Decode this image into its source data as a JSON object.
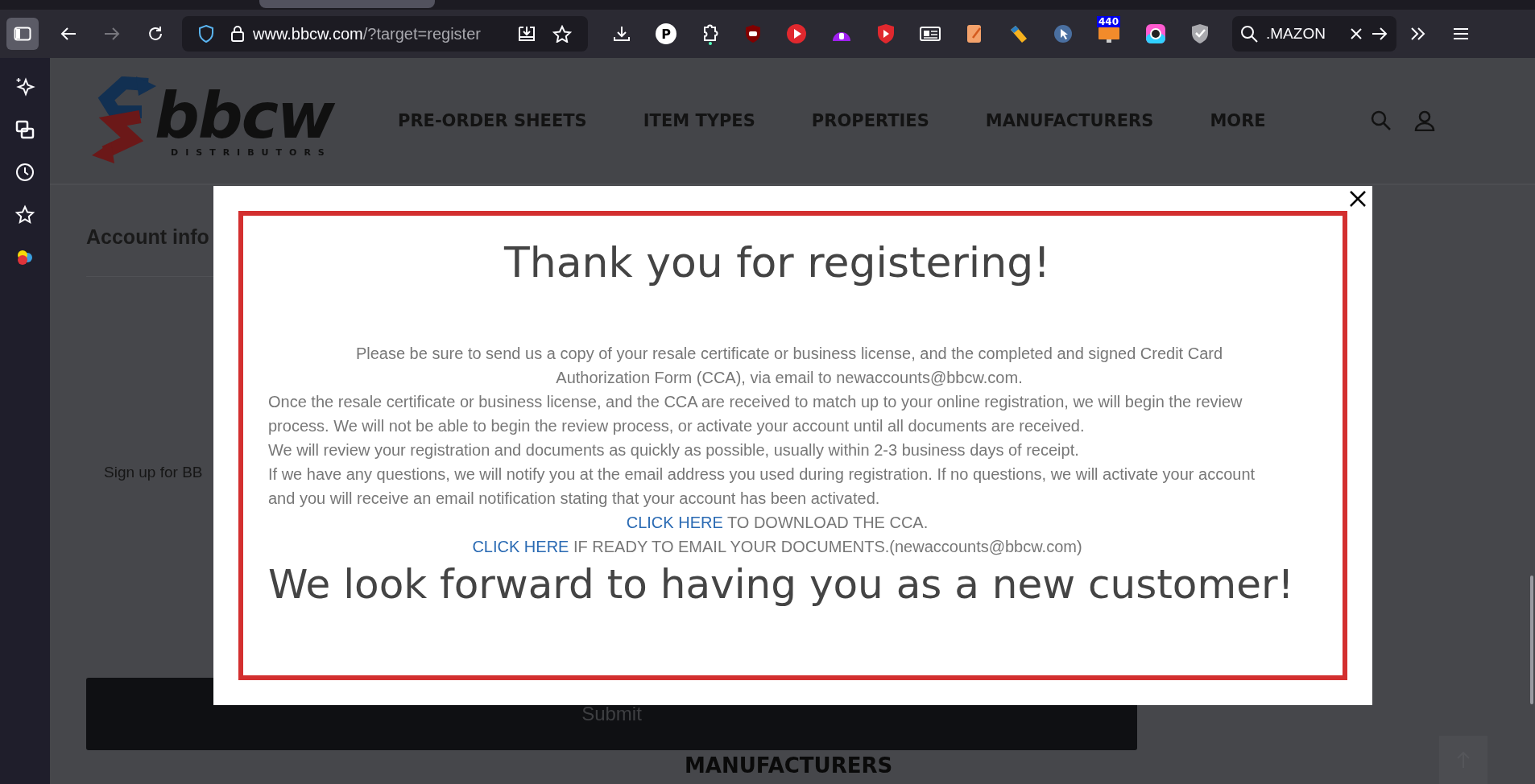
{
  "browser": {
    "url_host": "www.bbcw.com",
    "url_path": "/?target=register",
    "search_text": ".MAZON",
    "extension_letter": "P",
    "extension_badge": "440"
  },
  "site": {
    "logo_text": "bbcw",
    "logo_subtitle": "DISTRIBUTORS",
    "nav": [
      "PRE-ORDER SHEETS",
      "ITEM TYPES",
      "PROPERTIES",
      "MANUFACTURERS",
      "MORE"
    ]
  },
  "form": {
    "section_title": "Account info",
    "signup_text": "Sign up for BB",
    "submit": "Submit",
    "footer_heading": "MANUFACTURERS"
  },
  "modal": {
    "title": "Thank you for registering!",
    "intro": "Please be sure to send us a copy of your resale certificate or business license, and the completed and signed Credit Card Authorization Form (CCA), via email to newaccounts@bbcw.com.",
    "paragraphs": [
      "Once the resale certificate or business license, and the CCA are received to match up to your online registration, we will begin the review process. We will not be able to begin the review process, or activate your account until all documents are received.",
      "We will review your registration and documents as quickly as possible, usually within 2-3 business days of receipt.",
      "If we have any questions, we will notify you at the email address you used during registration. If no questions, we will activate your account and you will receive an email notification stating that your account has been activated."
    ],
    "links": [
      {
        "link": "CLICK HERE",
        "text": " TO DOWNLOAD THE CCA."
      },
      {
        "link": "CLICK HERE",
        "text": " IF READY TO EMAIL YOUR DOCUMENTS.(newaccounts@bbcw.com)"
      }
    ],
    "closing": "We look forward to having you as a new customer!"
  }
}
